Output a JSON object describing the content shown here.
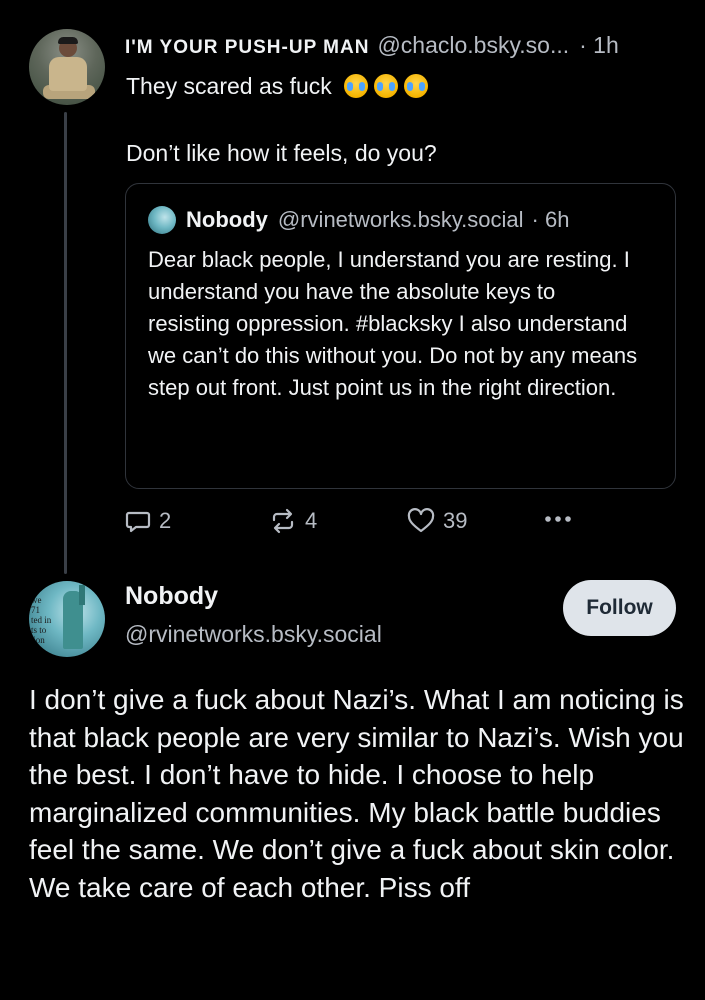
{
  "post": {
    "author_display_name": "I'M YOUR PUSH-UP MAN",
    "author_handle": "@chaclo.bsky.so...",
    "time": "· 1h",
    "text_line1": "They scared as fuck",
    "emoji_icon": "loudly-crying-face-icon",
    "emoji_count": 3,
    "text_line2": "Don’t like how it feels, do you?"
  },
  "quote": {
    "author_display_name": "Nobody",
    "author_handle": "@rvinetworks.bsky.social",
    "time": "· 6h",
    "text": "Dear black people, I understand you are resting. I understand you have the absolute keys to resisting oppression. #blacksky I also understand we can’t do this without you. Do not by any means step out front. Just point us in the right direction."
  },
  "actions": {
    "reply_count": "2",
    "repost_count": "4",
    "like_count": "39",
    "reply_icon": "reply-icon",
    "repost_icon": "repost-icon",
    "like_icon": "heart-icon",
    "more_icon": "more-options-icon"
  },
  "reply_post": {
    "author_display_name": "Nobody",
    "author_handle": "@rvinetworks.bsky.social",
    "follow_label": "Follow",
    "avatar_text": "we\n71\nted in\nts to\n.ion",
    "text": "I don’t give a fuck about Nazi’s. What I am noticing is that black people are very similar to Nazi’s. Wish you the best. I don’t have to hide. I choose to help marginalized communities. My black battle buddies feel the same. We don’t give a fuck about skin color. We take care of each other. Piss off"
  },
  "colors": {
    "background": "#000000",
    "text_primary": "#f1f3f5",
    "text_secondary": "#b7bcc4",
    "border": "#30343b",
    "follow_button_bg": "#dfe4ea"
  }
}
